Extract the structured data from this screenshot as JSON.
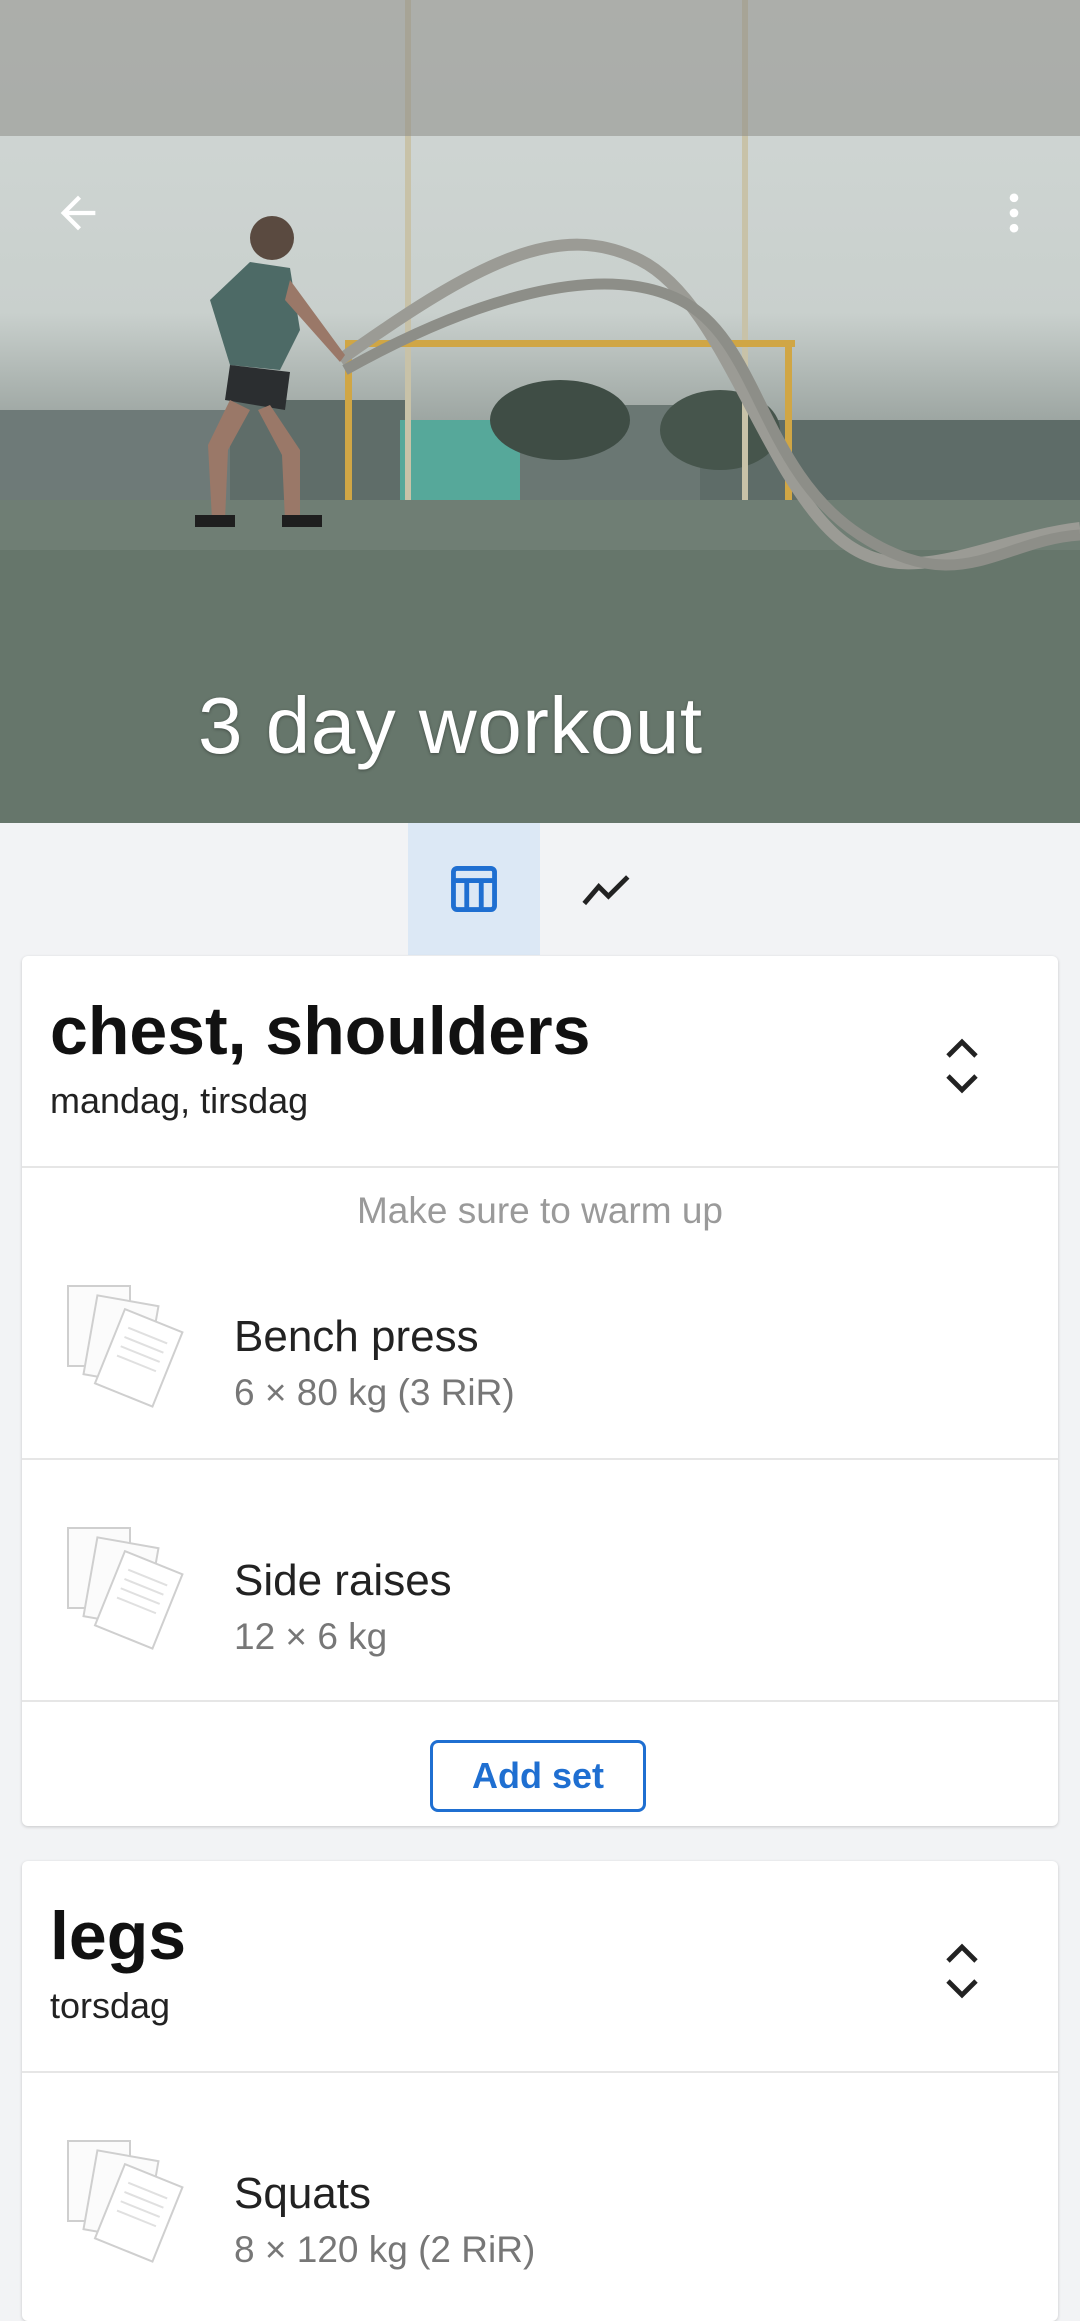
{
  "hero": {
    "title": "3 day workout"
  },
  "toolbar": {
    "back_icon": "arrow-left-icon",
    "more_icon": "more-vertical-icon"
  },
  "tabs": [
    {
      "icon": "table-icon",
      "active": true
    },
    {
      "icon": "trend-line-icon",
      "active": false
    }
  ],
  "colors": {
    "accent": "#1f6fd1",
    "active_tab_bg": "#dce8f5"
  },
  "workouts": [
    {
      "title": "chest, shoulders",
      "days": "mandag, tirsdag",
      "note": "Make sure to warm up",
      "exercises": [
        {
          "name": "Bench press",
          "detail": "6 × 80 kg  (3 RiR)"
        },
        {
          "name": "Side raises",
          "detail": "12 × 6 kg"
        }
      ],
      "add_label": "Add set"
    },
    {
      "title": "legs",
      "days": "torsdag",
      "exercises": [
        {
          "name": "Squats",
          "detail": "8 × 120 kg  (2 RiR)"
        }
      ]
    }
  ]
}
